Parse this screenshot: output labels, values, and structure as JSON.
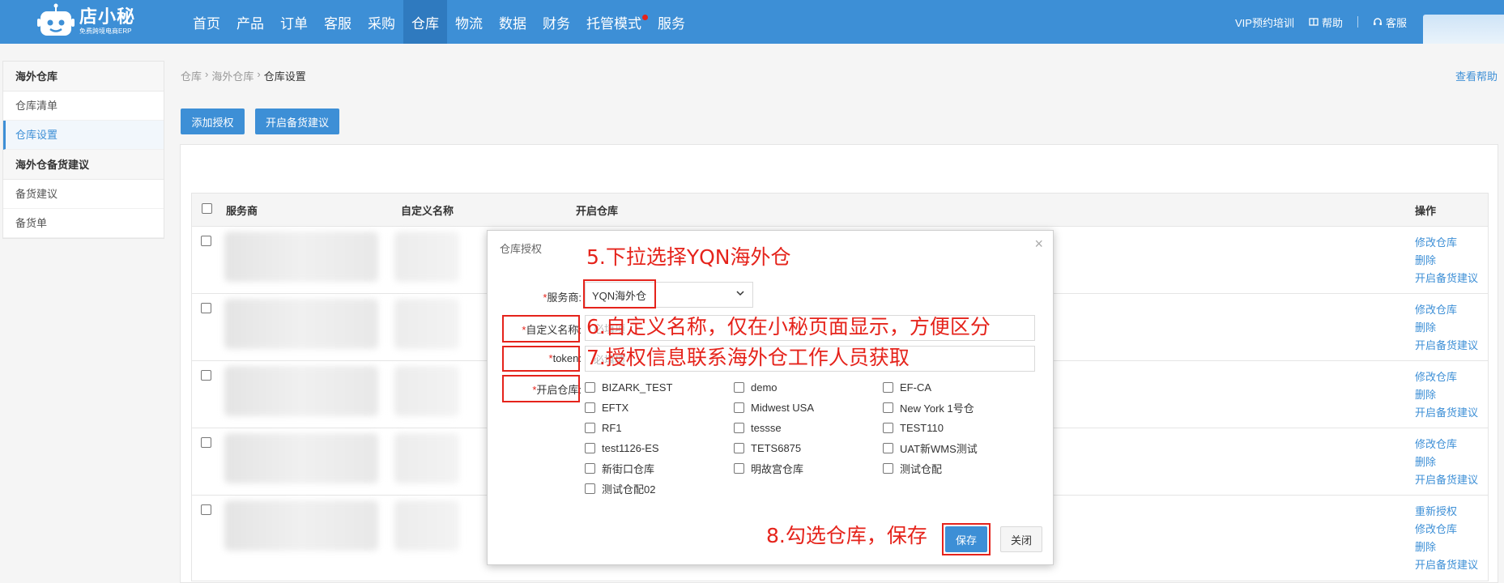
{
  "brand": {
    "name": "店小秘",
    "tagline": "免费跨境电商ERP"
  },
  "nav": {
    "items": [
      {
        "label": "首页",
        "active": false
      },
      {
        "label": "产品",
        "active": false
      },
      {
        "label": "订单",
        "active": false
      },
      {
        "label": "客服",
        "active": false
      },
      {
        "label": "采购",
        "active": false
      },
      {
        "label": "仓库",
        "active": true
      },
      {
        "label": "物流",
        "active": false
      },
      {
        "label": "数据",
        "active": false
      },
      {
        "label": "财务",
        "active": false
      },
      {
        "label": "托管模式",
        "active": false
      },
      {
        "label": "服务",
        "active": false
      }
    ],
    "right": {
      "vip": "VIP预约培训",
      "help": "帮助",
      "service": "客服"
    }
  },
  "sidebar": {
    "group1": "海外仓库",
    "group1_items": [
      "仓库清单",
      "仓库设置"
    ],
    "group2": "海外仓备货建议",
    "group2_items": [
      "备货建议",
      "备货单"
    ]
  },
  "breadcrumb": [
    "仓库",
    "海外仓库",
    "仓库设置"
  ],
  "help_link": "查看帮助",
  "toolbar": {
    "add_auth": "添加授权",
    "open_stock": "开启备货建议"
  },
  "table": {
    "headers": {
      "provider": "服务商",
      "custom_name": "自定义名称",
      "warehouses": "开启仓库",
      "actions": "操作"
    },
    "rows": [
      {
        "ops": [
          "修改仓库",
          "删除",
          "开启备货建议"
        ]
      },
      {
        "ops": [
          "修改仓库",
          "删除",
          "开启备货建议"
        ]
      },
      {
        "ops": [
          "修改仓库",
          "删除",
          "开启备货建议"
        ]
      },
      {
        "ops": [
          "修改仓库",
          "删除",
          "开启备货建议"
        ]
      },
      {
        "ops": [
          "重新授权",
          "修改仓库",
          "删除",
          "开启备货建议"
        ]
      }
    ]
  },
  "modal": {
    "title": "仓库授权",
    "provider_label": "服务商:",
    "provider_value": "YQN海外仓",
    "custom_name_label": "自定义名称:",
    "custom_name_placeholder": "必填项",
    "token_label": "token:",
    "token_placeholder": "必填项",
    "warehouses_label": "开启仓库:",
    "warehouses": [
      "BIZARK_TEST",
      "demo",
      "EF-CA",
      "EFTX",
      "Midwest USA",
      "New York 1号仓",
      "RF1",
      "tessse",
      "TEST110",
      "test1126-ES",
      "TETS6875",
      "UAT新WMS测试",
      "新街口仓库",
      "明故宫仓库",
      "测试仓配",
      "测试仓配02"
    ],
    "save": "保存",
    "close": "关闭"
  },
  "annotations": {
    "step5": "5.下拉选择YQN海外仓",
    "step6": "6.自定义名称，仅在小秘页面显示，方便区分",
    "step7": "7.授权信息联系海外仓工作人员获取",
    "step8": "8.勾选仓库，保存"
  },
  "colors": {
    "primary": "#3d8fd6",
    "annotation": "#e5231b"
  }
}
